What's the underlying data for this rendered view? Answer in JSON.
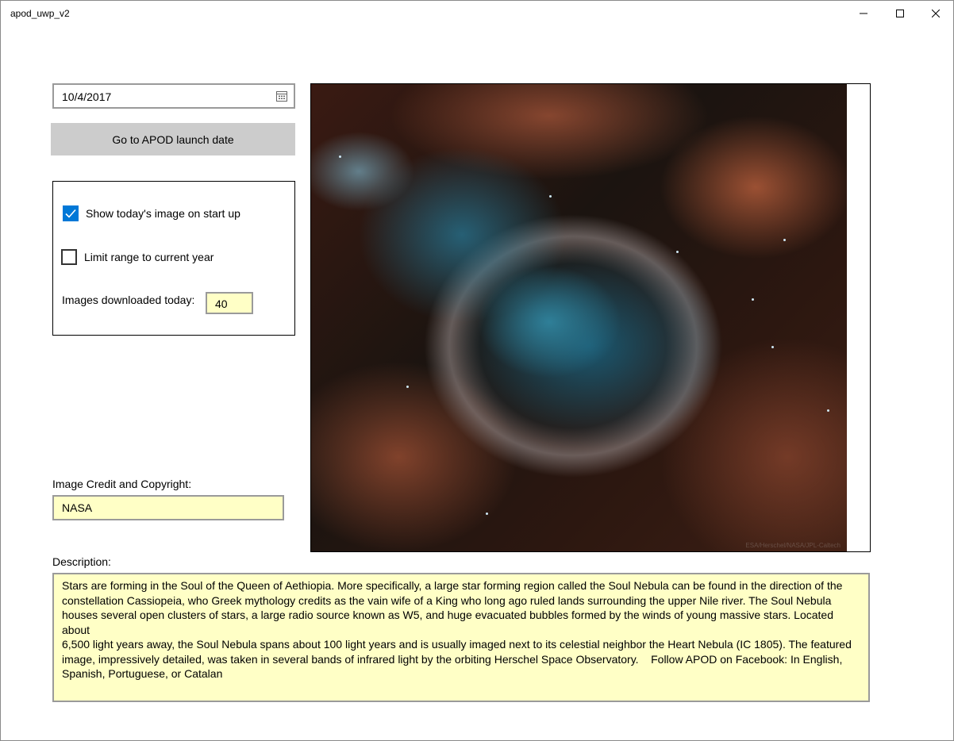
{
  "window": {
    "title": "apod_uwp_v2"
  },
  "date_picker": {
    "value": "10/4/2017",
    "icon": "calendar-icon"
  },
  "launch_button": {
    "label": "Go to APOD launch date"
  },
  "options": {
    "show_today": {
      "label": "Show today's image on start up",
      "checked": true
    },
    "limit_range": {
      "label": "Limit range to current year",
      "checked": false
    },
    "downloads_label": "Images downloaded today:",
    "downloads_value": "40"
  },
  "credit": {
    "label": "Image Credit and Copyright:",
    "value": "NASA"
  },
  "image": {
    "subject": "nebula-image",
    "watermark": "ESA/Herschel/NASA/JPL-Caltech"
  },
  "description": {
    "label": "Description:",
    "value": "Stars are forming in the Soul of the Queen of Aethiopia. More specifically, a large star forming region called the Soul Nebula can be found in the direction of the\nconstellation Cassiopeia, who Greek mythology credits as the vain wife of a King who long ago ruled lands surrounding the upper Nile river. The Soul Nebula\nhouses several open clusters of stars, a large radio source known as W5, and huge evacuated bubbles formed by the winds of young massive stars. Located about\n6,500 light years away, the Soul Nebula spans about 100 light years and is usually imaged next to its celestial neighbor the Heart Nebula (IC 1805). The featured\nimage, impressively detailed, was taken in several bands of infrared light by the orbiting Herschel Space Observatory.    Follow APOD on Facebook: In English,\nSpanish, Portuguese, or Catalan"
  },
  "colors": {
    "accent": "#0078d7",
    "field_background": "#ffffc6",
    "button_background": "#cccccc"
  }
}
